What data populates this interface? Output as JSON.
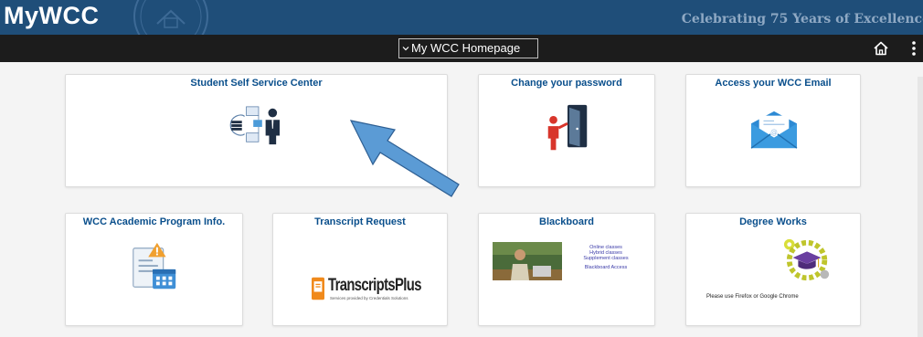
{
  "header": {
    "brand": "MyWCC",
    "tagline": "Celebrating 75 Years of Excellence"
  },
  "nav": {
    "homepage_select": "My WCC Homepage",
    "home_icon": "home-icon",
    "more_icon": "vertical-ellipsis-icon"
  },
  "tiles": {
    "student_self_service": {
      "title": "Student Self Service Center",
      "icon": "network-person-icon"
    },
    "change_password": {
      "title": "Change your password",
      "icon": "person-door-icon"
    },
    "email": {
      "title": "Access your WCC Email",
      "icon": "email-envelope-icon"
    },
    "academic_program": {
      "title": "WCC Academic Program Info.",
      "icon": "document-calendar-warning-icon"
    },
    "transcript": {
      "title": "Transcript Request",
      "logo_text": "TranscriptsPlus",
      "logo_sub": "Services provided by Credentials Solutions"
    },
    "blackboard": {
      "title": "Blackboard",
      "lines": [
        "Online classes",
        "Hybrid classes",
        "Supplement classes",
        "",
        "Blackboard Access"
      ]
    },
    "degree_works": {
      "title": "Degree Works",
      "icon": "graduation-cap-gear-icon",
      "note": "Please use Firefox or Google Chrome"
    }
  },
  "colors": {
    "banner": "#1f4e79",
    "navbar": "#1c1c1c",
    "tile_title": "#0a4f8c",
    "arrow": "#5b9bd5"
  }
}
